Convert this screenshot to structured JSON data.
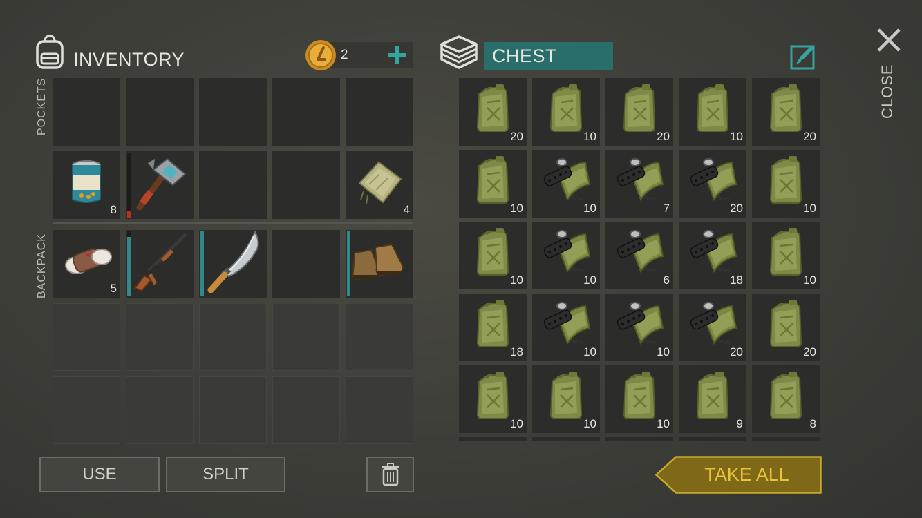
{
  "inventory": {
    "title": "INVENTORY",
    "coins": "2",
    "pockets_label": "POCKETS",
    "backpack_label": "BACKPACK",
    "pocket_slots": [
      {
        "item": "can",
        "qty": "8"
      },
      {
        "item": "hammer",
        "qty": "",
        "durability": 0.1,
        "dur_color": "#b3321f"
      },
      {
        "item": "",
        "qty": ""
      },
      {
        "item": "",
        "qty": ""
      },
      {
        "item": "cloth",
        "qty": "4"
      }
    ],
    "backpack_slots": [
      {
        "item": "bandage",
        "qty": "5"
      },
      {
        "item": "rifle",
        "qty": "",
        "durability": 0.92,
        "dur_color": "#2f8a89"
      },
      {
        "item": "machete",
        "qty": "",
        "durability": 1.0,
        "dur_color": "#2f8a89"
      },
      {
        "item": "",
        "qty": ""
      },
      {
        "item": "boots",
        "qty": "",
        "durability": 1.0,
        "dur_color": "#2f8a89"
      }
    ]
  },
  "chest": {
    "title": "CHEST",
    "rows": [
      [
        {
          "item": "jerrycan",
          "qty": "20"
        },
        {
          "item": "jerrycan",
          "qty": "10"
        },
        {
          "item": "jerrycan",
          "qty": "20"
        },
        {
          "item": "jerrycan",
          "qty": "10"
        },
        {
          "item": "jerrycan",
          "qty": "20"
        }
      ],
      [
        {
          "item": "jerrycan",
          "qty": "10"
        },
        {
          "item": "magazine",
          "qty": "10"
        },
        {
          "item": "magazine",
          "qty": "7"
        },
        {
          "item": "magazine",
          "qty": "20"
        },
        {
          "item": "jerrycan",
          "qty": "10"
        }
      ],
      [
        {
          "item": "jerrycan",
          "qty": "10"
        },
        {
          "item": "magazine",
          "qty": "10"
        },
        {
          "item": "magazine",
          "qty": "6"
        },
        {
          "item": "magazine",
          "qty": "18"
        },
        {
          "item": "jerrycan",
          "qty": "10"
        }
      ],
      [
        {
          "item": "jerrycan",
          "qty": "18"
        },
        {
          "item": "magazine",
          "qty": "10"
        },
        {
          "item": "magazine",
          "qty": "10"
        },
        {
          "item": "magazine",
          "qty": "20"
        },
        {
          "item": "jerrycan",
          "qty": "20"
        }
      ],
      [
        {
          "item": "jerrycan",
          "qty": "10"
        },
        {
          "item": "jerrycan",
          "qty": "10"
        },
        {
          "item": "jerrycan",
          "qty": "10"
        },
        {
          "item": "jerrycan",
          "qty": "9"
        },
        {
          "item": "jerrycan",
          "qty": "8"
        }
      ]
    ]
  },
  "buttons": {
    "use": "USE",
    "split": "SPLIT",
    "take_all": "TAKE ALL",
    "close": "CLOSE"
  },
  "colors": {
    "accent_teal": "#2f7f7c",
    "take_all_gold": "#a98a1e",
    "coin_gold": "#d99a2a"
  }
}
